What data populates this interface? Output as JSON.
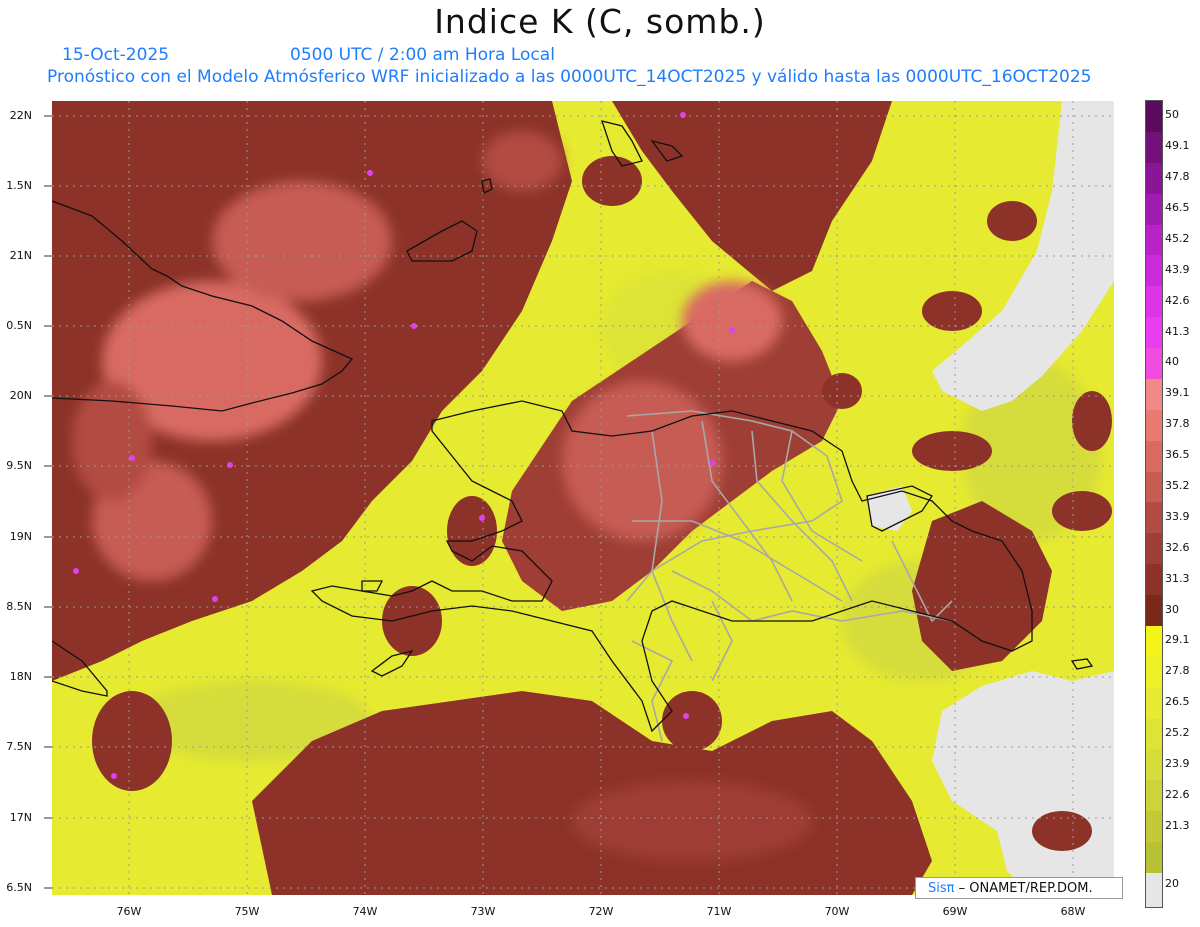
{
  "title": "Indice K (C, somb.)",
  "date": "15-Oct-2025",
  "valid_time": "0500 UTC / 2:00 am Hora Local",
  "model_info": "Pronóstico con el Modelo Atmósferico WRF inicializado a las 0000UTC_14OCT2025 y válido hasta las  0000UTC_16OCT2025",
  "credit": {
    "logo": "Sisπ",
    "text": "– ONAMET/REP.DOM."
  },
  "lat_labels": [
    "22N",
    "1.5N",
    "21N",
    "0.5N",
    "20N",
    "9.5N",
    "19N",
    "8.5N",
    "18N",
    "7.5N",
    "17N",
    "6.5N"
  ],
  "lon_labels": [
    "76W",
    "75W",
    "74W",
    "73W",
    "72W",
    "71W",
    "70W",
    "69W",
    "68W"
  ],
  "colorbar": {
    "labels": [
      "50",
      "49.1",
      "47.8",
      "46.5",
      "45.2",
      "43.9",
      "42.6",
      "41.3",
      "40",
      "39.1",
      "37.8",
      "36.5",
      "35.2",
      "33.9",
      "32.6",
      "31.3",
      "30",
      "29.1",
      "27.8",
      "26.5",
      "25.2",
      "23.9",
      "22.6",
      "21.3",
      "20"
    ],
    "colors": [
      "#5c0a5c",
      "#74107a",
      "#8a1596",
      "#a01cb0",
      "#b822c8",
      "#cc2ad8",
      "#dd34e6",
      "#ec3cf0",
      "#f04ce0",
      "#f08a86",
      "#e87a72",
      "#d86a62",
      "#c65c52",
      "#b24c42",
      "#9e3e34",
      "#8c3228",
      "#7a2818",
      "#f4f41a",
      "#eef028",
      "#e6ea30",
      "#deE436",
      "#d6dc3a",
      "#ccd43c",
      "#c2ca38",
      "#b8c034"
    ],
    "below_color": "#e6e6e6"
  },
  "legend_field": "Indice K",
  "units": "C"
}
